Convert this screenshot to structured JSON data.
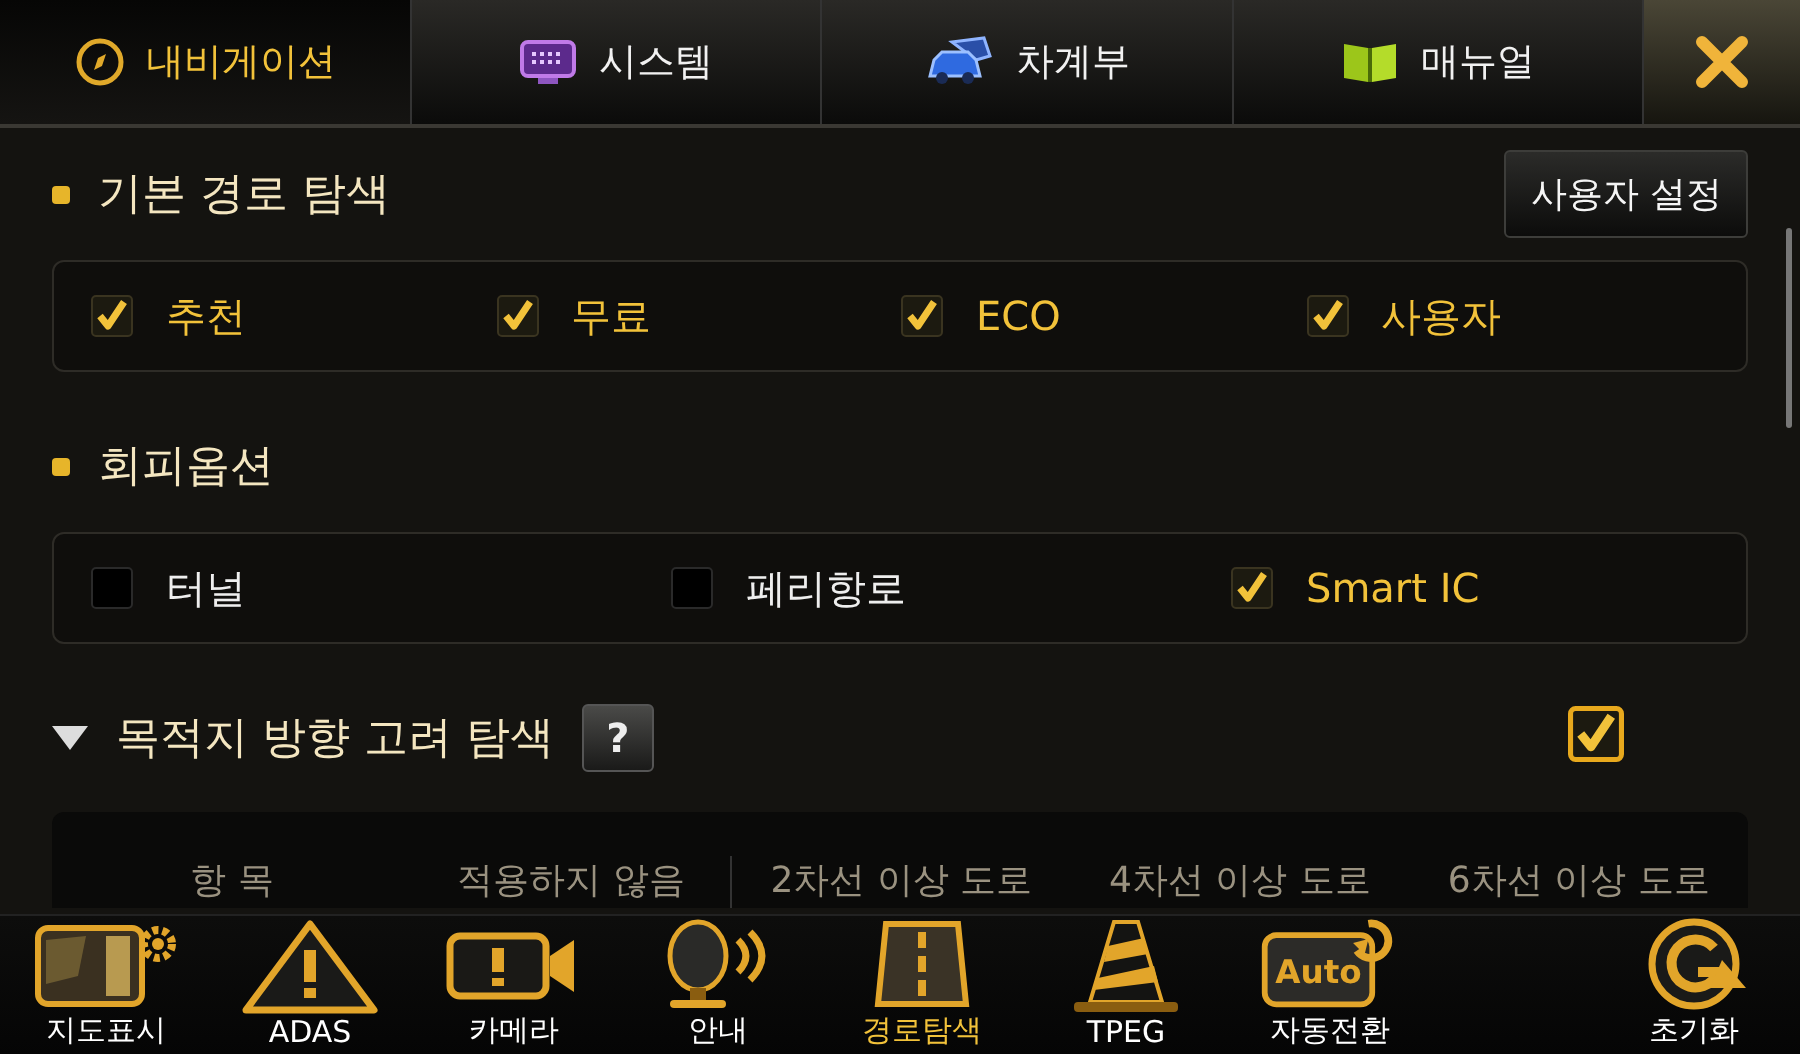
{
  "tabs": [
    {
      "label": "내비게이션",
      "kind": "compass",
      "selected": true
    },
    {
      "label": "시스템",
      "kind": "monitor",
      "selected": false
    },
    {
      "label": "차계부",
      "kind": "car",
      "selected": false
    },
    {
      "label": "매뉴얼",
      "kind": "book",
      "selected": false
    }
  ],
  "sections": [
    {
      "kind": "options",
      "title": "기본 경로 탐색",
      "button": "사용자 설정",
      "options": [
        {
          "label": "추천",
          "checked": true
        },
        {
          "label": "무료",
          "checked": true
        },
        {
          "label": "ECO",
          "checked": true
        },
        {
          "label": "사용자",
          "checked": true
        }
      ]
    },
    {
      "kind": "options",
      "title": "회피옵션",
      "options": [
        {
          "label": "터널",
          "checked": false
        },
        {
          "label": "페리항로",
          "checked": false
        },
        {
          "label": "Smart IC",
          "checked": true
        }
      ]
    },
    {
      "kind": "toggle",
      "title": "목적지 방향 고려 탐색",
      "expanded": true,
      "help": "?",
      "checked": true,
      "table_header": [
        "항 목",
        "적용하지 않음",
        "2차선 이상 도로",
        "4차선 이상 도로",
        "6차선 이상 도로"
      ]
    }
  ],
  "dock": [
    {
      "label": "지도표시",
      "kind": "map",
      "selected": false
    },
    {
      "label": "ADAS",
      "kind": "warning",
      "selected": false
    },
    {
      "label": "카메라",
      "kind": "camera",
      "selected": false
    },
    {
      "label": "안내",
      "kind": "mic",
      "selected": false
    },
    {
      "label": "경로탐색",
      "kind": "route",
      "selected": true
    },
    {
      "label": "TPEG",
      "kind": "cone",
      "selected": false
    },
    {
      "label": "자동전환",
      "kind": "auto",
      "badge": "Auto",
      "selected": false
    },
    {
      "label": "초기화",
      "kind": "reset",
      "selected": false
    }
  ]
}
